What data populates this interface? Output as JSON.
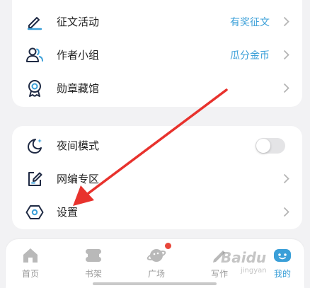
{
  "menu_top": {
    "items": [
      {
        "label": "征文活动",
        "hint": "有奖征文",
        "icon": "pen-icon"
      },
      {
        "label": "作者小组",
        "hint": "瓜分金币",
        "icon": "users-icon"
      },
      {
        "label": "勋章藏馆",
        "hint": "",
        "icon": "medal-icon"
      }
    ]
  },
  "menu_bottom": {
    "items": [
      {
        "label": "夜间模式",
        "icon": "moon-icon",
        "toggle": false
      },
      {
        "label": "网编专区",
        "icon": "edit-box-icon"
      },
      {
        "label": "设置",
        "icon": "hexagon-settings-icon"
      }
    ]
  },
  "tabbar": {
    "tabs": [
      {
        "label": "首页",
        "icon": "home-icon"
      },
      {
        "label": "书架",
        "icon": "bookshelf-icon"
      },
      {
        "label": "广场",
        "icon": "planet-icon",
        "badge": true
      },
      {
        "label": "写作",
        "icon": "pencil-icon"
      },
      {
        "label": "我的",
        "icon": "profile-icon",
        "active": true
      }
    ]
  },
  "watermark": {
    "text": "Baidu",
    "sub": "jingyan"
  },
  "colors": {
    "accent": "#3a9fd8",
    "arrow": "#e8322d",
    "badge": "#e8463a"
  }
}
